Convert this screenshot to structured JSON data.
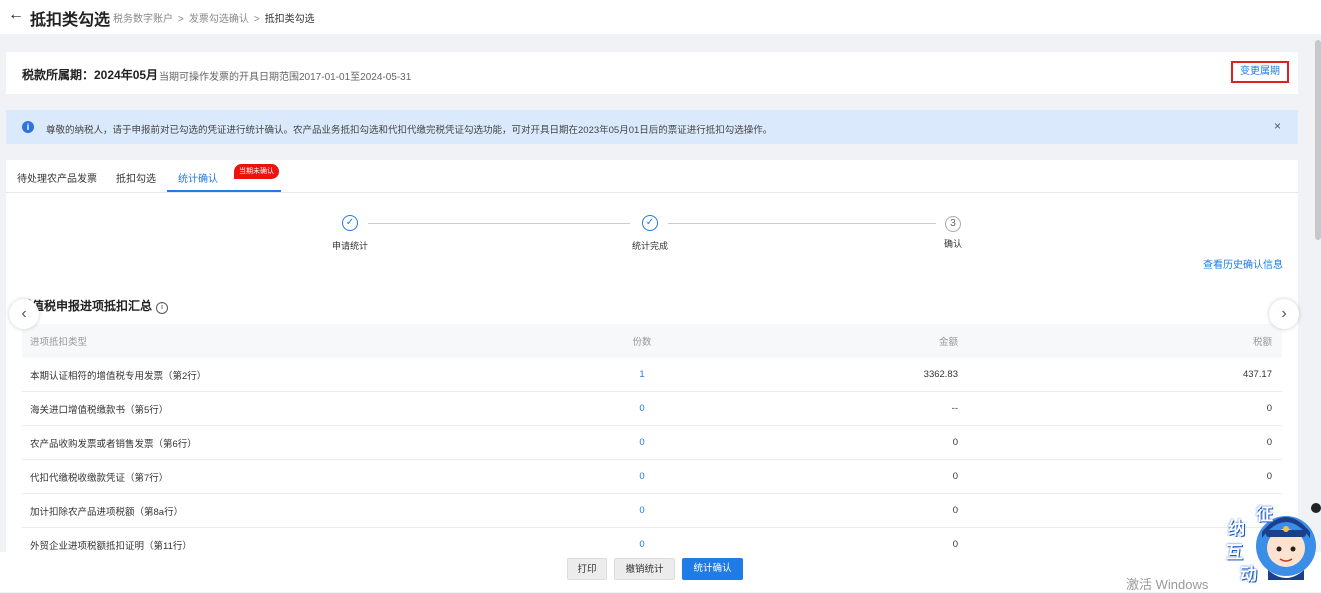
{
  "header": {
    "back_icon": "left-arrow-icon",
    "title": "抵扣类勾选",
    "breadcrumbs": [
      "税务数字账户",
      "发票勾选确认",
      "抵扣类勾选"
    ],
    "separator": ">"
  },
  "period": {
    "label": "税款所属期：2024年05月",
    "range_text": "当期可操作发票的开具日期范围2017-01-01至2024-05-31",
    "change_button": "变更属期"
  },
  "alert": {
    "icon": "info-icon",
    "text": "尊敬的纳税人，请于申报前对已勾选的凭证进行统计确认。农产品业务抵扣勾选和代扣代缴完税凭证勾选功能，可对开具日期在2023年05月01日后的票证进行抵扣勾选操作。",
    "close": "×"
  },
  "tabs": [
    {
      "label": "待处理农产品发票"
    },
    {
      "label": "抵扣勾选"
    },
    {
      "label": "统计确认",
      "active": true,
      "badge": "当期未确认"
    }
  ],
  "steps": [
    {
      "label": "申请统计",
      "status": "done",
      "mark": "✓"
    },
    {
      "label": "统计完成",
      "status": "done",
      "mark": "✓"
    },
    {
      "label": "确认",
      "status": "pending",
      "mark": "3"
    }
  ],
  "history_link": "查看历史确认信息",
  "section": {
    "title": "增值税申报进项抵扣汇总",
    "info_icon": "ⓘ"
  },
  "table": {
    "headers": [
      "进项抵扣类型",
      "份数",
      "金额",
      "税额"
    ],
    "rows": [
      [
        "本期认证相符的增值税专用发票（第2行）",
        "1",
        "3362.83",
        "437.17"
      ],
      [
        "海关进口增值税缴款书（第5行）",
        "0",
        "--",
        "0"
      ],
      [
        "农产品收购发票或者销售发票（第6行）",
        "0",
        "0",
        "0"
      ],
      [
        "代扣代缴税收缴款凭证（第7行）",
        "0",
        "0",
        "0"
      ],
      [
        "加计扣除农产品进项税额（第8a行）",
        "0",
        "0",
        ""
      ],
      [
        "外贸企业进项税额抵扣证明（第11行）",
        "0",
        "0",
        ""
      ]
    ]
  },
  "buttons": {
    "print": "打印",
    "cancel_stat": "撤销统计",
    "confirm": "统计确认"
  },
  "watermark": "激活 Windows",
  "mascot": {
    "chars": [
      "征",
      "纳",
      "互",
      "动"
    ]
  },
  "colors": {
    "primary": "#1f7be6",
    "alert_bg": "#dbe9fc",
    "badge": "#e8140f",
    "highlight_border": "#e02020"
  }
}
